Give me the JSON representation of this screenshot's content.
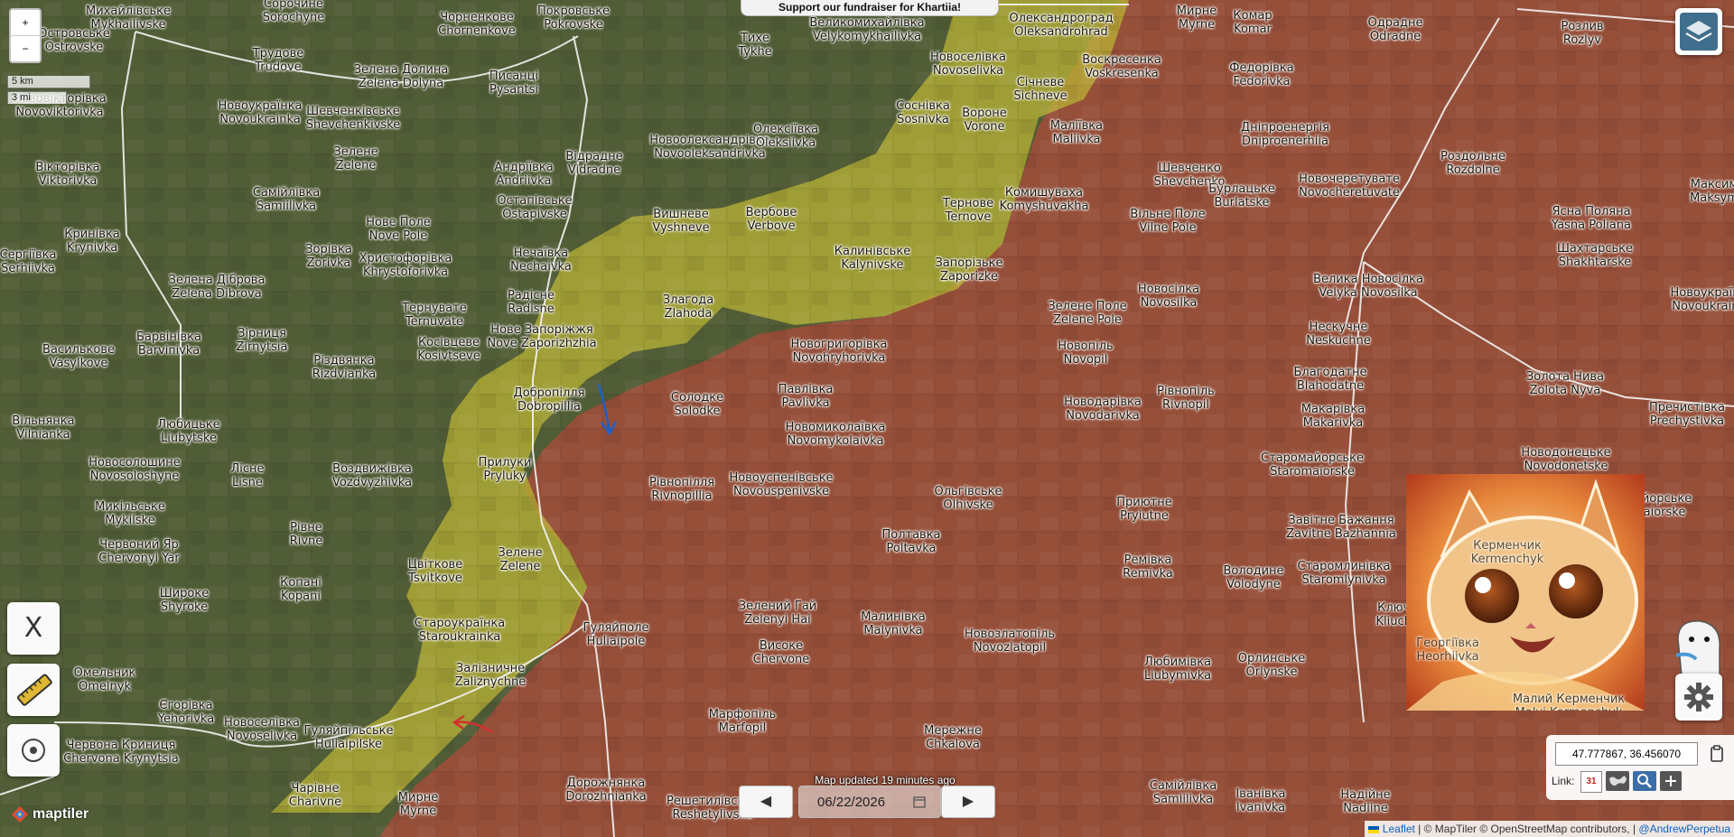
{
  "banner": {
    "text": "Support our fundraiser for Khartiia!"
  },
  "zoom": {
    "in": "+",
    "out": "−"
  },
  "scale": {
    "km": "5 km",
    "mi": "3 mi"
  },
  "tools": {
    "x_label": "X"
  },
  "footer": {
    "updated": "Map updated 19 minutes ago",
    "date": "06/22/2026",
    "prev": "◀",
    "next": "▶"
  },
  "coords": {
    "value": "47.777867, 36.456070",
    "link_label": "Link:",
    "calendar_day": "31"
  },
  "attribution": {
    "leaflet": "Leaflet",
    "rest": "| © MapTiler © OpenStreetMap contributors, |",
    "author": "@AndrewPerpetua"
  },
  "brand": {
    "logo": "maptiler"
  },
  "colors": {
    "occupied": "#a84a3a",
    "contested": "#c8bd36",
    "ukraine": "#4f5a35",
    "front_arrow_blue": "#1f5fc7",
    "front_arrow_red": "#d32f2f"
  },
  "places": [
    {
      "id": "mykhailivske",
      "t": "Михайлівське\nMykhailivske"
    },
    {
      "id": "sorochyne",
      "t": "Сорочине\nSorochyne"
    },
    {
      "id": "chornenkove",
      "t": "Чорненкове\nChornenkove"
    },
    {
      "id": "pokrovske",
      "t": "Покровське\nPokrovske"
    },
    {
      "id": "velykomykhailivka",
      "t": "Великомихайлівка\nVelykomykhailivka"
    },
    {
      "id": "oleksandrograd",
      "t": "Олександроград\nOleksandrohrad"
    },
    {
      "id": "myrne1",
      "t": "Мирне\nMyrne"
    },
    {
      "id": "komar",
      "t": "Комар\nKomar"
    },
    {
      "id": "odradne",
      "t": "Одрадне\nOdradne"
    },
    {
      "id": "rozliv",
      "t": "Розлив\nRozlyv"
    },
    {
      "id": "ostrovske",
      "t": "Островське\nOstrovske"
    },
    {
      "id": "tykhe",
      "t": "Тихе\nTykhe"
    },
    {
      "id": "novoselivka1",
      "t": "Новоселівка\nNovoselivka"
    },
    {
      "id": "voskresenka",
      "t": "Воскресенка\nVoskresenka"
    },
    {
      "id": "fedorivka",
      "t": "Федорівка\nFedorivka"
    },
    {
      "id": "trudove",
      "t": "Трудове\nTrudove"
    },
    {
      "id": "zelenadolyna",
      "t": "Зелена Долина\nZelena Dolyna"
    },
    {
      "id": "pysantsi",
      "t": "Писанці\nPysantsi"
    },
    {
      "id": "sichneve",
      "t": "Січневе\nSichneve"
    },
    {
      "id": "novoviktorivka",
      "t": "Нововікторівка\nNovoviktorivka"
    },
    {
      "id": "novoukrainka",
      "t": "Новоукраїнка\nNovoukrainka"
    },
    {
      "id": "shevchenkivske",
      "t": "Шевченківське\nShevchenkivske"
    },
    {
      "id": "sosnivka",
      "t": "Соснівка\nSosnivka"
    },
    {
      "id": "vorone",
      "t": "Вороне\nVorone"
    },
    {
      "id": "malivka",
      "t": "Маліївка\nMaliivka"
    },
    {
      "id": "dniproenergia",
      "t": "Дніпроенергія\nDniproenerhiia"
    },
    {
      "id": "vidradne",
      "t": "Відрадне\nVidradne"
    },
    {
      "id": "novooleksandrivka",
      "t": "Новоолександрівка\nNovooleksandrivka"
    },
    {
      "id": "oleksiivka",
      "t": "Олексіївка\nOleksiivka"
    },
    {
      "id": "rozdolne",
      "t": "Роздольне\nRozdolne"
    },
    {
      "id": "zelene1",
      "t": "Зелене\nZelene"
    },
    {
      "id": "andriivka",
      "t": "Андріївка\nAndriivka"
    },
    {
      "id": "viktorivka",
      "t": "Вікторівка\nViktorivka"
    },
    {
      "id": "shevchenko",
      "t": "Шевченко\nShevchenko"
    },
    {
      "id": "burlatske",
      "t": "Бурлацьке\nBurlatske"
    },
    {
      "id": "novocheretuvate",
      "t": "Новочеретувате\nNovocheretuvate"
    },
    {
      "id": "maksym",
      "t": "Максим\nMaksym"
    },
    {
      "id": "samiilivka",
      "t": "Самійлівка\nSamiilivka"
    },
    {
      "id": "ostapivske",
      "t": "Остапівське\nOstapivske"
    },
    {
      "id": "komyshuvakha",
      "t": "Комишуваха\nKomyshuvakha"
    },
    {
      "id": "ternove",
      "t": "Тернове\nTernove"
    },
    {
      "id": "vyshneve",
      "t": "Вишневе\nVyshneve"
    },
    {
      "id": "verbove",
      "t": "Вербове\nVerbove"
    },
    {
      "id": "vilnepole",
      "t": "Вільне Поле\nVilne Pole"
    },
    {
      "id": "yasnapoliana",
      "t": "Ясна Поляна\nYasna Poliana"
    },
    {
      "id": "novepole",
      "t": "Нове Поле\nNove Pole"
    },
    {
      "id": "krynivka",
      "t": "Кринівка\nKrynivka"
    },
    {
      "id": "zorivka",
      "t": "Зорівка\nZorivka"
    },
    {
      "id": "khrystoforivka",
      "t": "Христофорівка\nKhrystoforivka"
    },
    {
      "id": "nechaivka",
      "t": "Нечаївка\nNechaivka"
    },
    {
      "id": "kalynivske",
      "t": "Калинівське\nKalynivske"
    },
    {
      "id": "zaporizke",
      "t": "Запорізьке\nZaporizke"
    },
    {
      "id": "shakhtarske",
      "t": "Шахтарське\nShakhtarske"
    },
    {
      "id": "serhiivka",
      "t": "Сергіївка\nSerhiivka"
    },
    {
      "id": "zelenadibrova",
      "t": "Зелена Діброва\nZelena Dibrova"
    },
    {
      "id": "ternuvate",
      "t": "Тернувате\nTernuvate"
    },
    {
      "id": "radisne",
      "t": "Радісне\nRadisne"
    },
    {
      "id": "zlahoda",
      "t": "Злагода\nZlahoda"
    },
    {
      "id": "velykanovosilka",
      "t": "Велика Новосілка\nVelyka Novosilka"
    },
    {
      "id": "novosilka",
      "t": "Новосілка\nNovosilka"
    },
    {
      "id": "zelenepole",
      "t": "Зелене Поле\nZelene Pole"
    },
    {
      "id": "novoukrainka2",
      "t": "Новоукраїнка\nNovoukrainka"
    },
    {
      "id": "barvinivka",
      "t": "Барвінівка\nBarvinivka"
    },
    {
      "id": "zirnytsia",
      "t": "Зірниця\nZirnytsia"
    },
    {
      "id": "vasylkove",
      "t": "Василькове\nVasylkove"
    },
    {
      "id": "kosivtseve",
      "t": "Косівцеве\nKosivtseve"
    },
    {
      "id": "novezaporizhzhia",
      "t": "Нове Запоріжжя\nNove Zaporizhzhia"
    },
    {
      "id": "novohryhorivka",
      "t": "Новогригорівка\nNovohryhorivka"
    },
    {
      "id": "neskuchne",
      "t": "Нескучне\nNeskuchne"
    },
    {
      "id": "novopil",
      "t": "Новопіль\nNovopil"
    },
    {
      "id": "rizdvianka",
      "t": "Різдвянка\nRizdvianka"
    },
    {
      "id": "blahodatne",
      "t": "Благодатне\nBlahodatne"
    },
    {
      "id": "zolotanyva",
      "t": "Золота Нива\nZolota Nyva"
    },
    {
      "id": "dobropillia",
      "t": "Добропілля\nDobropillia"
    },
    {
      "id": "solodke",
      "t": "Солодке\nSolodke"
    },
    {
      "id": "pavlivka",
      "t": "Павлівка\nPavlivka"
    },
    {
      "id": "novodarivka",
      "t": "Новодарівка\nNovodarivka"
    },
    {
      "id": "rivnopil",
      "t": "Рівнопіль\nRivnopil"
    },
    {
      "id": "makarivka",
      "t": "Макарівка\nMakarivka"
    },
    {
      "id": "prechystivka",
      "t": "Пречистівка\nPrechystivka"
    },
    {
      "id": "vilnianka",
      "t": "Вільнянка\nVilnianka"
    },
    {
      "id": "liubytske",
      "t": "Любицьке\nLiubytske"
    },
    {
      "id": "novomykolaivka",
      "t": "Новомиколаївка\nNovomykolaivka"
    },
    {
      "id": "novodonetske",
      "t": "Новодонецьке\nNovodonetske"
    },
    {
      "id": "staromaiorske",
      "t": "Старомайорське\nStaromaiorske"
    },
    {
      "id": "novosoloshyne",
      "t": "Новосолошине\nNovosoloshyne"
    },
    {
      "id": "lisne",
      "t": "Лісне\nLisne"
    },
    {
      "id": "vozdvyzhivka",
      "t": "Воздвижівка\nVozdvyzhivka"
    },
    {
      "id": "pryluky",
      "t": "Прилуки\nPryluky"
    },
    {
      "id": "rivnopillia",
      "t": "Рівнопілля\nRivnopillia"
    },
    {
      "id": "novouspenivske",
      "t": "Новоуспенівське\nNovouspenivske"
    },
    {
      "id": "olhivske",
      "t": "Ольгівське\nOlhivske"
    },
    {
      "id": "priiutne",
      "t": "Приютне\nPryiutne"
    },
    {
      "id": "mykilske",
      "t": "Микільське\nMykilske"
    },
    {
      "id": "chervonyiar",
      "t": "Червоний Яр\nChervonyi Yar"
    },
    {
      "id": "rivne",
      "t": "Рівне\nRivne"
    },
    {
      "id": "zelene2",
      "t": "Зелене\nZelene"
    },
    {
      "id": "poltavka",
      "t": "Полтавка\nPoltavka"
    },
    {
      "id": "zavitnebazhannia",
      "t": "Завітне Бажання\nZavitne Bazhannia"
    },
    {
      "id": "novomaiorske",
      "t": "Новомайорське\nNovomaiorske"
    },
    {
      "id": "tsvitkove",
      "t": "Цвіткове\nTsvitkove"
    },
    {
      "id": "remivka",
      "t": "Ремівка\nRemivka"
    },
    {
      "id": "volodyne",
      "t": "Володине\nVolodyne"
    },
    {
      "id": "staromlynivka",
      "t": "Старомлинівка\nStaromlynivka"
    },
    {
      "id": "shyroke",
      "t": "Широке\nShyroke"
    },
    {
      "id": "kopani",
      "t": "Копані\nKopani"
    },
    {
      "id": "zelenyigai",
      "t": "Зелений Гай\nZelenyi Hai"
    },
    {
      "id": "malynivka",
      "t": "Малинівка\nMalynivka"
    },
    {
      "id": "starukrainka",
      "t": "Староукраїнка\nStaroukrainka"
    },
    {
      "id": "huliaipole",
      "t": "Гуляйполе\nHuliaipole"
    },
    {
      "id": "novozlatopil",
      "t": "Новозлатопіль\nNovozlatopil"
    },
    {
      "id": "vysoke",
      "t": "Високе\nChervone"
    },
    {
      "id": "liubymivka",
      "t": "Любимівка\nLiubymivka"
    },
    {
      "id": "orlynske",
      "t": "Орлинське\nOrlynske"
    },
    {
      "id": "omelnyk",
      "t": "Омельник\nOmelnyk"
    },
    {
      "id": "zaliznychne",
      "t": "Залізничне\nZaliznychne"
    },
    {
      "id": "yehorivka",
      "t": "Єгорівка\nYehorivka"
    },
    {
      "id": "novoselivka2",
      "t": "Новоселівка\nNovoselivka"
    },
    {
      "id": "marfopil",
      "t": "Марфопіль\nMarfopil"
    },
    {
      "id": "huliaipilske",
      "t": "Гуляйпільське\nHuliaipilske"
    },
    {
      "id": "chervonakrynytsia",
      "t": "Червона Криниця\nChervona Krynytsia"
    },
    {
      "id": "merezhne",
      "t": "Мережне\nChkalova"
    },
    {
      "id": "charivne",
      "t": "Чарівне\nCharivne"
    },
    {
      "id": "dorozhnianka",
      "t": "Дорожнянка\nDorozhnianka"
    },
    {
      "id": "myrne2",
      "t": "Мирне\nMyrne"
    },
    {
      "id": "reshetylivske",
      "t": "Решетилівське\nReshetylivske"
    },
    {
      "id": "samiilivka2",
      "t": "Самійлівка\nSamiilivka"
    },
    {
      "id": "ivanivka",
      "t": "Іванівка\nIvanivka"
    },
    {
      "id": "nadiine",
      "t": "Надійне\nNadiine"
    },
    {
      "id": "kliuchove",
      "t": "Ключове\nKliuchove"
    },
    {
      "id": "kermenchyk",
      "t": "Керменчик\nKermenchyk"
    },
    {
      "id": "heorhiivka",
      "t": "Георгіївка\nHeorhiivka"
    },
    {
      "id": "malyikermenchyk",
      "t": "Малий Керменчик\nMalyi Kermenchyk"
    }
  ]
}
